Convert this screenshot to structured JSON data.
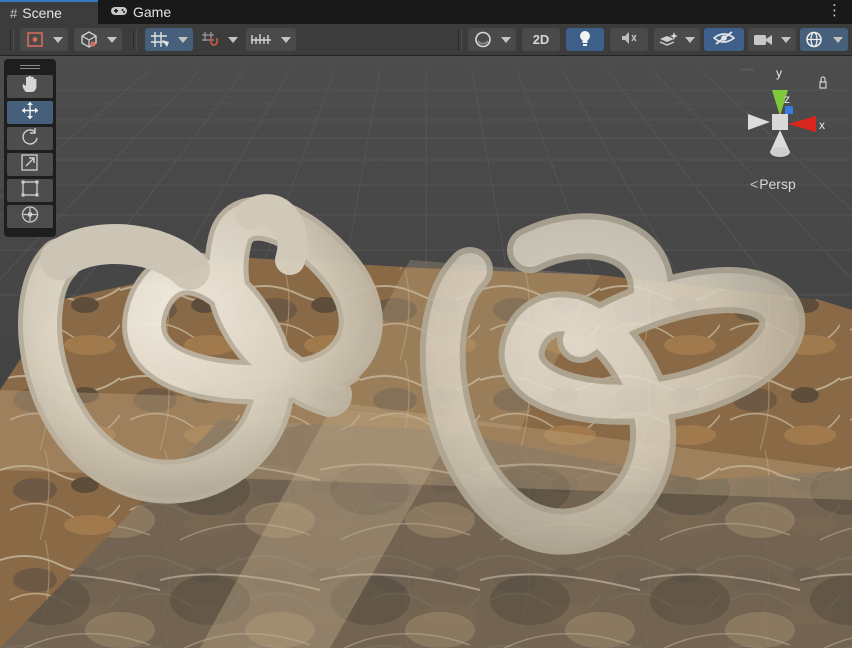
{
  "tabs": [
    {
      "label": "Scene",
      "icon": "grid-hash-icon",
      "active": true
    },
    {
      "label": "Game",
      "icon": "gamepad-icon",
      "active": false
    }
  ],
  "toolbar": {
    "two_d_label": "2D"
  },
  "gizmo": {
    "axis_y": "y",
    "axis_z": "z",
    "axis_x": "x",
    "projection_label": "Persp"
  },
  "colors": {
    "accent": "#46607c",
    "x_axis": "#d8261c",
    "y_axis": "#7fc83a",
    "z_axis": "#3a7be0",
    "knot": "#e3dccc",
    "ground": "#8b6b48"
  },
  "tools": [
    "hand-icon",
    "move-icon",
    "rotate-icon",
    "scale-icon",
    "rect-tool-icon",
    "transform-icon"
  ]
}
